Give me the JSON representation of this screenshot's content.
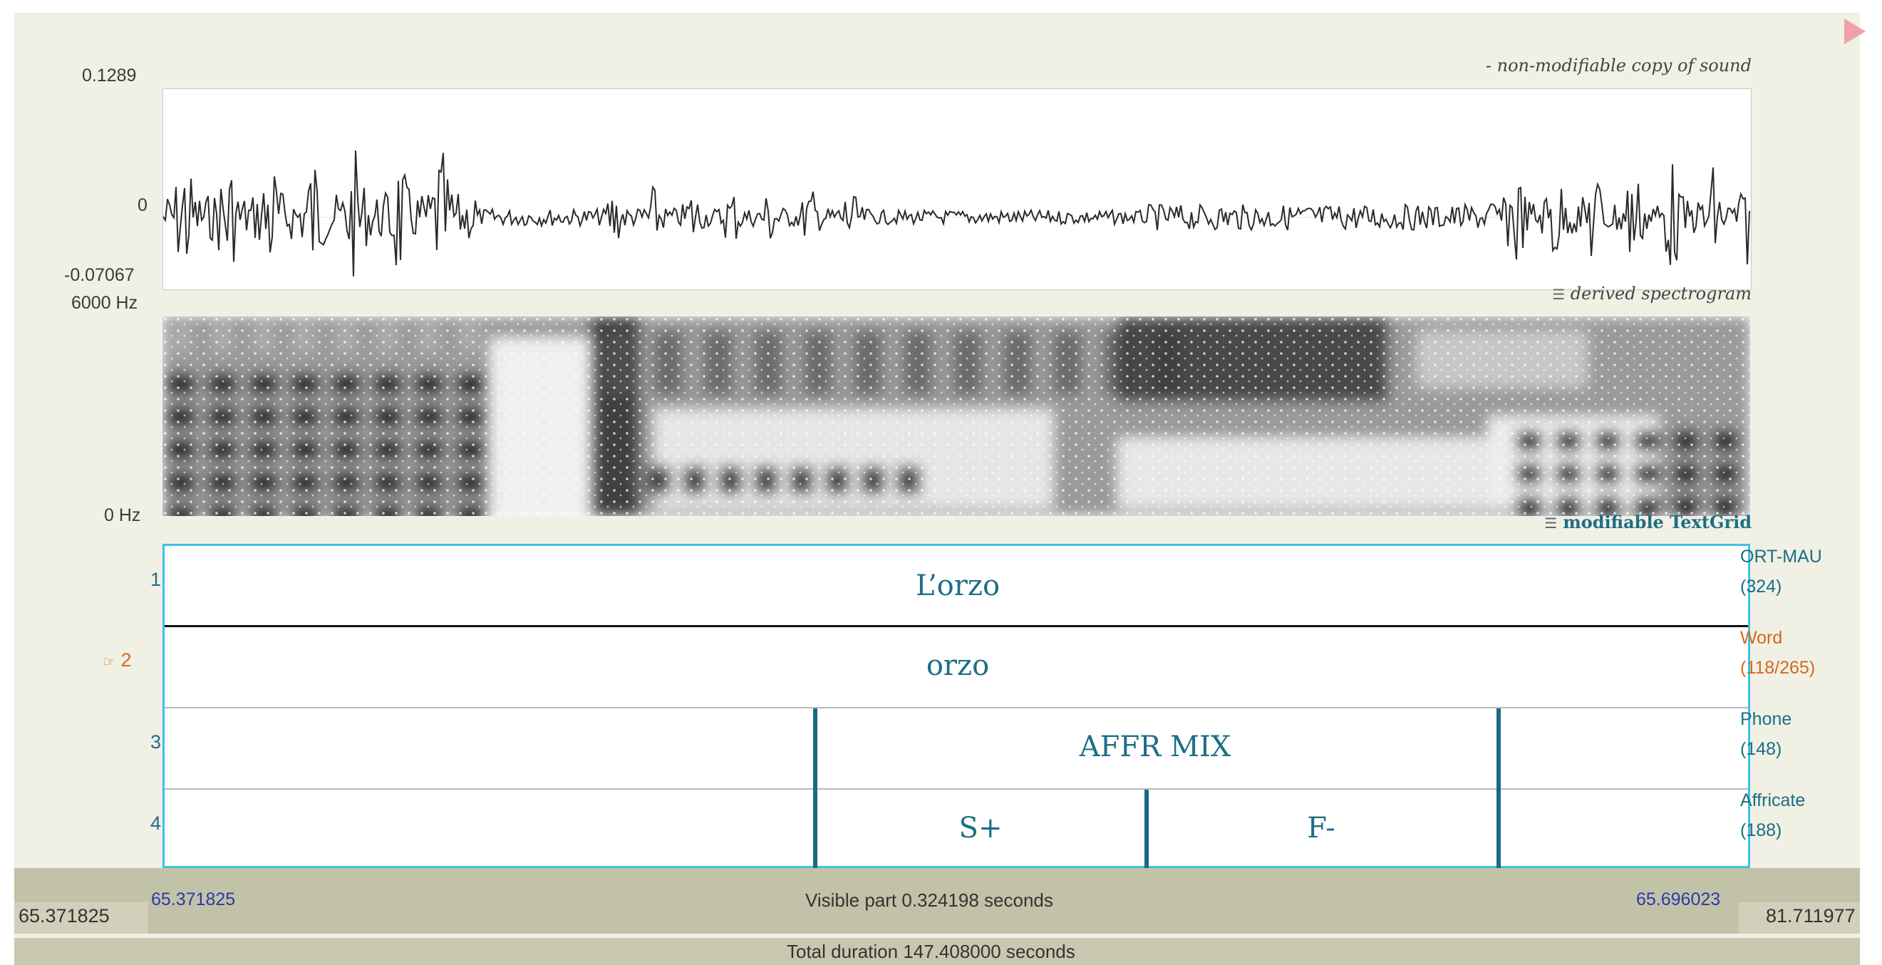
{
  "waveform": {
    "max_label": "0.1289",
    "zero_label": "0",
    "min_label": "-0.07067",
    "annotation": "- non-modifiable copy of sound"
  },
  "spectrogram": {
    "top_label": "6000 Hz",
    "bottom_label": "0 Hz",
    "annotation": "derived spectrogram"
  },
  "textgrid": {
    "annotation": "modifiable TextGrid",
    "tiers": [
      {
        "number": "1",
        "name": "ORT-MAU",
        "count": "(324)",
        "intervals": [
          {
            "text": "L’orzo"
          }
        ]
      },
      {
        "number": "2",
        "name": "Word",
        "count": "(118/265)",
        "intervals": [
          {
            "text": "orzo"
          }
        ]
      },
      {
        "number": "3",
        "name": "Phone",
        "count": "(148)",
        "intervals": [
          {
            "text": ""
          },
          {
            "text": "AFFR MIX"
          },
          {
            "text": ""
          }
        ]
      },
      {
        "number": "4",
        "name": "Affricate",
        "count": "(188)",
        "intervals": [
          {
            "text": ""
          },
          {
            "text": "S+"
          },
          {
            "text": "F-"
          },
          {
            "text": ""
          }
        ]
      }
    ]
  },
  "colors": {
    "tier_text": "#1d6e85",
    "active_tier": "#d36a1c",
    "textgrid_border": "#3dc3e3",
    "time_blue": "#2a3aa8"
  },
  "time": {
    "window_start": "65.371825",
    "window_end": "65.696023",
    "visible_label": "Visible part 0.324198 seconds",
    "left_outside": "65.371825",
    "right_outside": "81.711977",
    "total_label": "Total duration 147.408000 seconds"
  },
  "icons": {
    "play": "play-triangle-icon",
    "pointer": "hand-pointer-icon",
    "menu": "three-bar-menu-icon"
  }
}
